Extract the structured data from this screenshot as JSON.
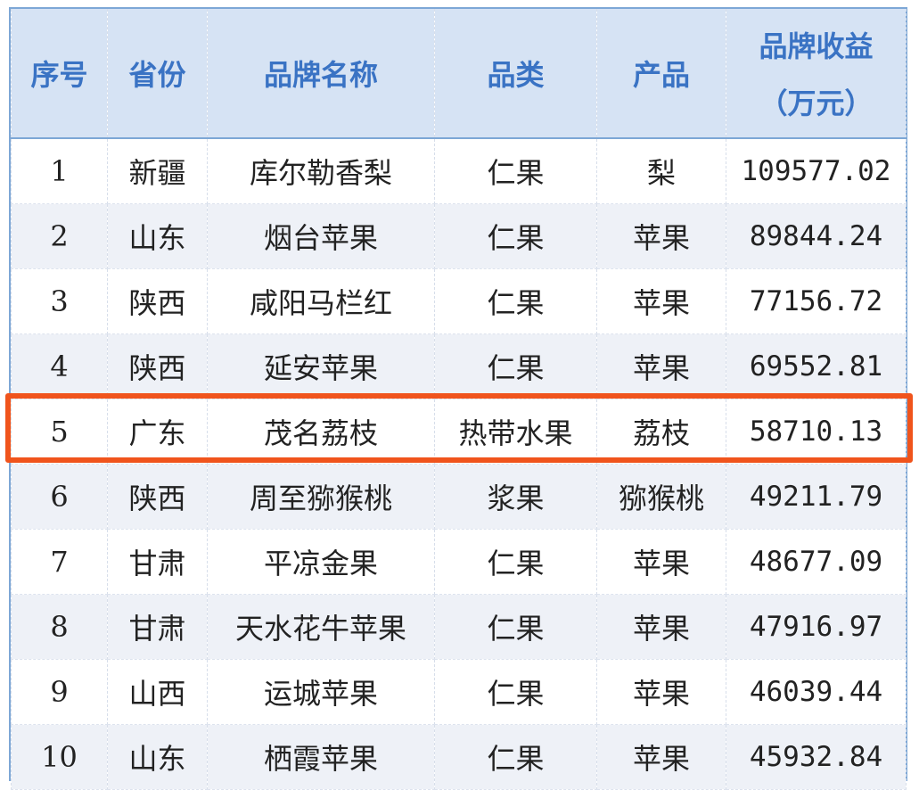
{
  "table": {
    "headers": [
      "序号",
      "省份",
      "品牌名称",
      "品类",
      "产品"
    ],
    "revenue_header_line1": "品牌收益",
    "revenue_header_line2": "（万元）",
    "rows": [
      [
        "1",
        "新疆",
        "库尔勒香梨",
        "仁果",
        "梨",
        "109577.02"
      ],
      [
        "2",
        "山东",
        "烟台苹果",
        "仁果",
        "苹果",
        "89844.24"
      ],
      [
        "3",
        "陕西",
        "咸阳马栏红",
        "仁果",
        "苹果",
        "77156.72"
      ],
      [
        "4",
        "陕西",
        "延安苹果",
        "仁果",
        "苹果",
        "69552.81"
      ],
      [
        "5",
        "广东",
        "茂名荔枝",
        "热带水果",
        "荔枝",
        "58710.13"
      ],
      [
        "6",
        "陕西",
        "周至猕猴桃",
        "浆果",
        "猕猴桃",
        "49211.79"
      ],
      [
        "7",
        "甘肃",
        "平凉金果",
        "仁果",
        "苹果",
        "48677.09"
      ],
      [
        "8",
        "甘肃",
        "天水花牛苹果",
        "仁果",
        "苹果",
        "47916.97"
      ],
      [
        "9",
        "山西",
        "运城苹果",
        "仁果",
        "苹果",
        "46039.44"
      ],
      [
        "10",
        "山东",
        "栖霞苹果",
        "仁果",
        "苹果",
        "45932.84"
      ]
    ],
    "highlighted_row": 5
  },
  "colors": {
    "header_bg": "#d6e3f4",
    "header_text": "#3a73c4",
    "border": "#7da7d6",
    "row_alt_bg": "#eef1f7",
    "highlight": "#f0541c"
  }
}
